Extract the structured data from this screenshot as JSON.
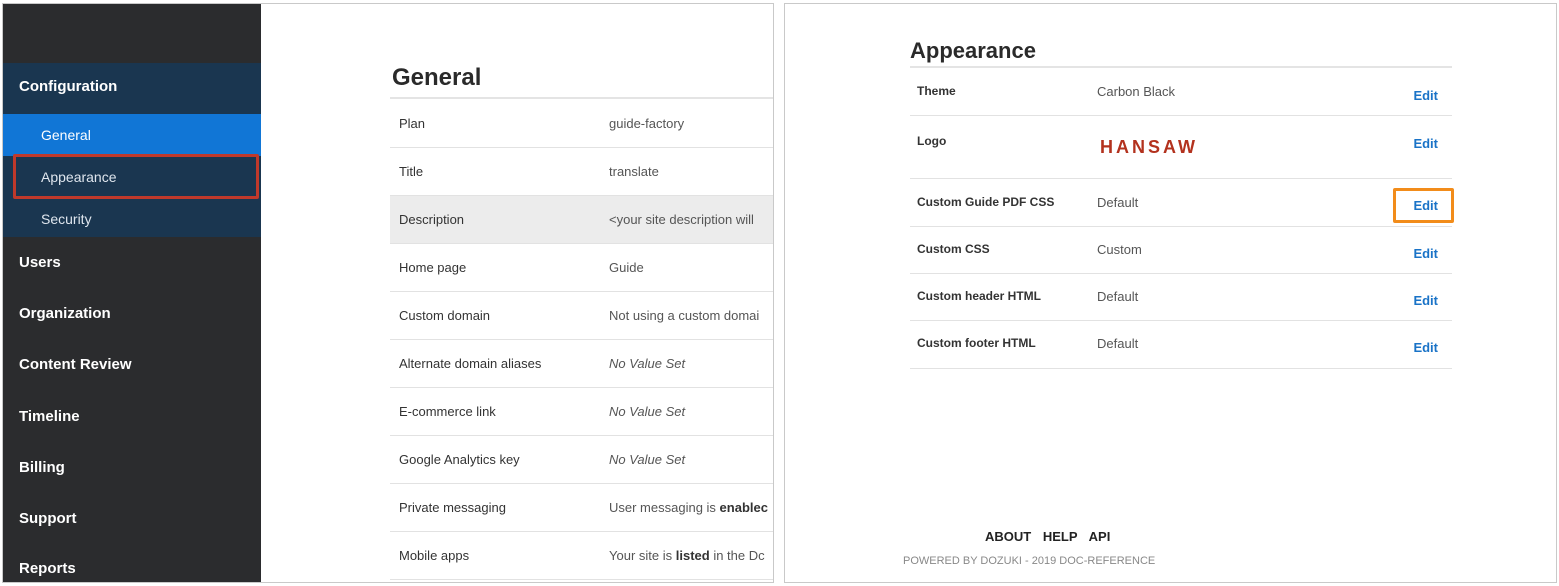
{
  "left": {
    "sidebar": {
      "section": "Configuration",
      "subitems": [
        "General",
        "Appearance",
        "Security"
      ],
      "items": [
        "Users",
        "Organization",
        "Content Review",
        "Timeline",
        "Billing",
        "Support",
        "Reports"
      ]
    },
    "general": {
      "title": "General",
      "rows": [
        {
          "key": "Plan",
          "value": "guide-factory"
        },
        {
          "key": "Title",
          "value": "translate"
        },
        {
          "key": "Description",
          "value": "<your site description will"
        },
        {
          "key": "Home page",
          "value": "Guide"
        },
        {
          "key": "Custom domain",
          "value": "Not using a custom domai"
        },
        {
          "key": "Alternate domain aliases",
          "value": "No Value Set"
        },
        {
          "key": "E-commerce link",
          "value": "No Value Set"
        },
        {
          "key": "Google Analytics key",
          "value": "No Value Set"
        },
        {
          "key": "Private messaging",
          "value_prefix": "User messaging is ",
          "value_bold": "enablec"
        },
        {
          "key": "Mobile apps",
          "value_prefix": "Your site is ",
          "value_bold": "listed",
          "value_suffix": " in the Dc"
        }
      ]
    }
  },
  "right": {
    "appearance": {
      "title": "Appearance",
      "edit_label": "Edit",
      "rows": [
        {
          "key": "Theme",
          "value": "Carbon Black"
        },
        {
          "key": "Logo",
          "logo_text": "HANSAW"
        },
        {
          "key": "Custom Guide PDF CSS",
          "value": "Default"
        },
        {
          "key": "Custom CSS",
          "value": "Custom"
        },
        {
          "key": "Custom header HTML",
          "value": "Default"
        },
        {
          "key": "Custom footer HTML",
          "value": "Default"
        }
      ]
    },
    "footer": {
      "links": [
        "ABOUT",
        "HELP",
        "API"
      ],
      "powered": "POWERED BY DOZUKI - 2019 DOC-REFERENCE"
    }
  },
  "colors": {
    "sidebar_bg": "#2b2c2e",
    "config_bg": "#1a3650",
    "active_bg": "#1176d6",
    "highlight_red": "#c0392b",
    "highlight_orange": "#f28c1a",
    "link_blue": "#1a73c7",
    "logo_red": "#b3321e"
  }
}
